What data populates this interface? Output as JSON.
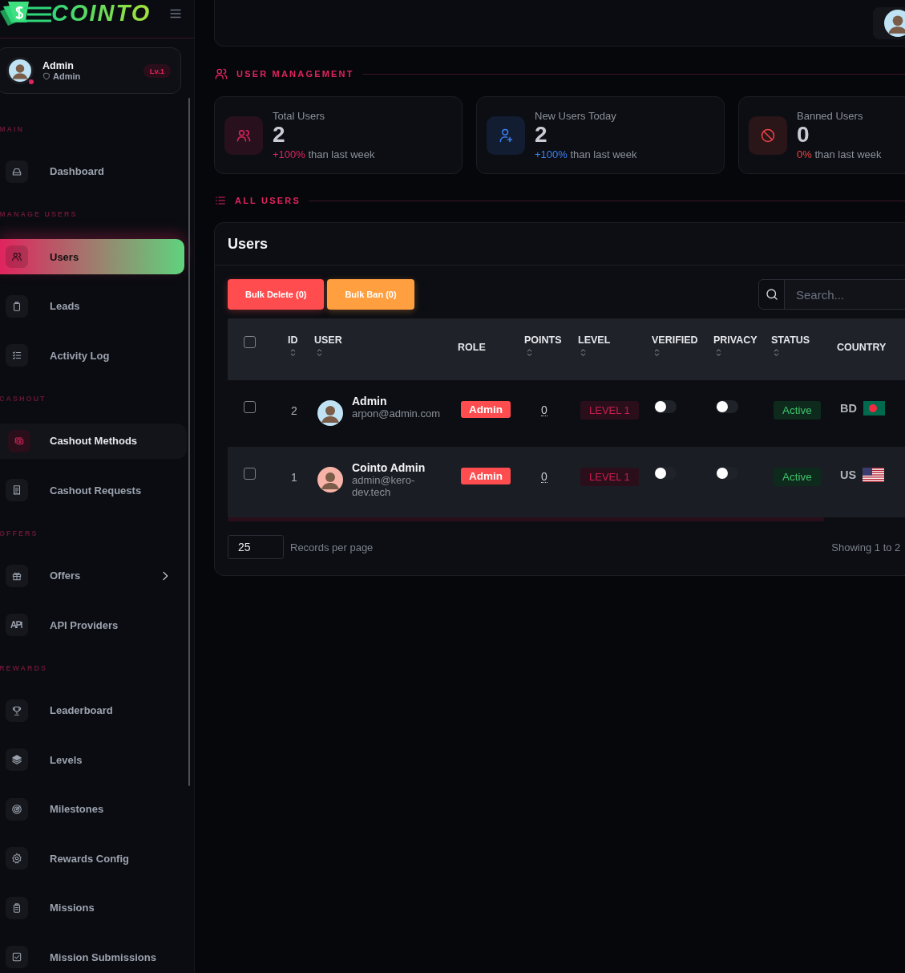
{
  "brand": {
    "name": "COINTO"
  },
  "profile": {
    "name": "Admin",
    "role": "Admin",
    "level_badge": "Lv.1"
  },
  "sidebar": {
    "sections": [
      {
        "label": "MAIN",
        "items": [
          {
            "label": "Dashboard",
            "selected": false,
            "highlighted": false,
            "expandable": false
          }
        ]
      },
      {
        "label": "MANAGE USERS",
        "items": [
          {
            "label": "Users",
            "selected": true,
            "highlighted": false,
            "expandable": false
          },
          {
            "label": "Leads",
            "selected": false,
            "highlighted": false,
            "expandable": false
          },
          {
            "label": "Activity Log",
            "selected": false,
            "highlighted": false,
            "expandable": false
          }
        ]
      },
      {
        "label": "CASHOUT",
        "items": [
          {
            "label": "Cashout Methods",
            "selected": false,
            "highlighted": true,
            "expandable": false
          },
          {
            "label": "Cashout Requests",
            "selected": false,
            "highlighted": false,
            "expandable": false
          }
        ]
      },
      {
        "label": "OFFERS",
        "items": [
          {
            "label": "Offers",
            "selected": false,
            "highlighted": false,
            "expandable": true
          },
          {
            "label": "API Providers",
            "selected": false,
            "highlighted": false,
            "expandable": false
          }
        ]
      },
      {
        "label": "REWARDS",
        "items": [
          {
            "label": "Leaderboard",
            "selected": false,
            "highlighted": false,
            "expandable": false
          },
          {
            "label": "Levels",
            "selected": false,
            "highlighted": false,
            "expandable": false
          },
          {
            "label": "Milestones",
            "selected": false,
            "highlighted": false,
            "expandable": false
          },
          {
            "label": "Rewards Config",
            "selected": false,
            "highlighted": false,
            "expandable": false
          },
          {
            "label": "Missions",
            "selected": false,
            "highlighted": false,
            "expandable": false
          },
          {
            "label": "Mission Submissions",
            "selected": false,
            "highlighted": false,
            "expandable": false
          }
        ]
      }
    ]
  },
  "user_management": {
    "title": "USER MANAGEMENT",
    "stats": [
      {
        "label": "Total Users",
        "value": "2",
        "change": "+100%",
        "change_text": "than last week",
        "color": "#e0245e"
      },
      {
        "label": "New Users Today",
        "value": "2",
        "change": "+100%",
        "change_text": "than last week",
        "color": "#3b82f6"
      },
      {
        "label": "Banned Users",
        "value": "0",
        "change": "0%",
        "change_text": "than last week",
        "color": "#ef4444"
      }
    ]
  },
  "all_users": {
    "title": "ALL USERS",
    "card_title": "Users",
    "buttons": [
      {
        "label": "Bulk Delete (0)",
        "kind": "danger"
      },
      {
        "label": "Bulk Ban (0)",
        "kind": "warning"
      }
    ],
    "search": {
      "placeholder": "Search..."
    },
    "table": {
      "select_all": {
        "checked": false
      },
      "columns": [
        {
          "label": "ID",
          "sortable": true
        },
        {
          "label": "USER",
          "sortable": true
        },
        {
          "label": "ROLE",
          "sortable": false
        },
        {
          "label": "POINTS",
          "sortable": true
        },
        {
          "label": "LEVEL",
          "sortable": true
        },
        {
          "label": "VERIFIED",
          "sortable": true
        },
        {
          "label": "PRIVACY",
          "sortable": true
        },
        {
          "label": "STATUS",
          "sortable": true
        },
        {
          "label": "COUNTRY",
          "sortable": false
        }
      ],
      "rows": [
        {
          "checked": false,
          "id": "2",
          "name": "Admin",
          "email": "arpon@admin.com",
          "role": "Admin",
          "points": "0",
          "level": "LEVEL 1",
          "verified": false,
          "privacy": false,
          "status": "Active",
          "country": "BD"
        },
        {
          "checked": false,
          "id": "1",
          "name": "Cointo Admin",
          "email": "admin@kero-dev.tech",
          "role": "Admin",
          "points": "0",
          "level": "LEVEL 1",
          "verified": false,
          "privacy": false,
          "status": "Active",
          "country": "US"
        }
      ]
    },
    "per_page": "25",
    "per_page_label": "Records per page",
    "showing": "Showing 1 to 2"
  }
}
